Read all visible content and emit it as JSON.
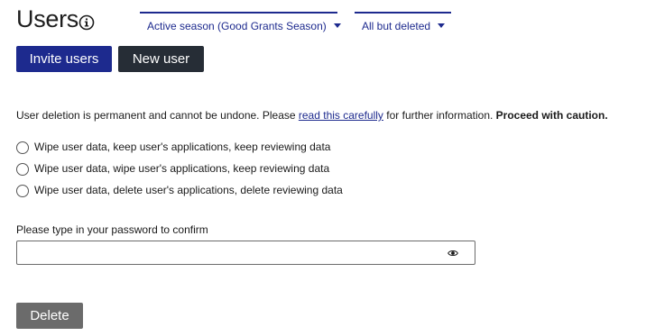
{
  "page": {
    "title": "Users"
  },
  "filters": {
    "season": "Active season (Good Grants Season)",
    "status": "All but deleted"
  },
  "actions": {
    "invite_label": "Invite users",
    "new_label": "New user"
  },
  "warning": {
    "text_before": "User deletion is permanent and cannot be undone. Please ",
    "link_text": "read this carefully",
    "text_after": " for further information. ",
    "emphasis": "Proceed with caution."
  },
  "options": [
    "Wipe user data, keep user's applications, keep reviewing data",
    "Wipe user data, wipe user's applications, keep reviewing data",
    "Wipe user data, delete user's applications, delete reviewing data"
  ],
  "password": {
    "label": "Please type in your password to confirm",
    "value": ""
  },
  "delete_label": "Delete",
  "icons": {
    "info": "info-icon",
    "caret": "chevron-down-icon",
    "eye": "eye-icon"
  },
  "colors": {
    "primary": "#1d2a8e",
    "dark": "#262d36",
    "disabled": "#6b6b6b"
  }
}
